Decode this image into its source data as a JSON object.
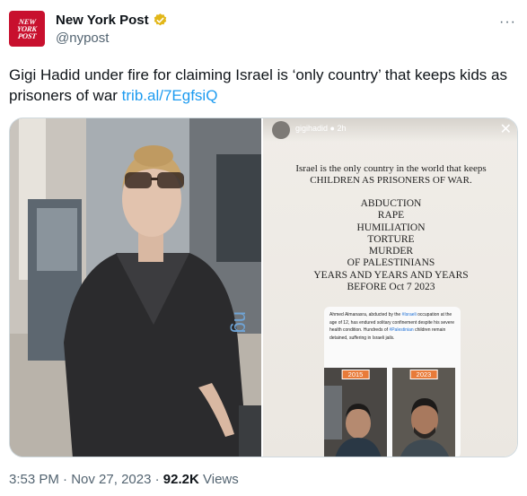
{
  "account": {
    "display_name": "New York Post",
    "handle": "@nypost",
    "avatar_text": [
      "NEW",
      "YORK",
      "POST"
    ],
    "verified": true,
    "brand_color": "#c8102e",
    "verified_color": "#e2b719"
  },
  "more_icon": "more-horizontal-icon",
  "tweet": {
    "text": "Gigi Hadid under fire for claiming Israel is ‘only country’ that keeps kids as prisoners of war",
    "link": "trib.al/7EgfsiQ"
  },
  "media": {
    "story": {
      "user": "gigihadid",
      "age": "2h",
      "line1": "Israel is the only country in the world that keeps",
      "line2": "CHILDREN AS PRISONERS OF WAR.",
      "list": [
        "ABDUCTION",
        "RAPE",
        "HUMILIATION",
        "TORTURE",
        "MURDER",
        "OF PALESTINIANS",
        "YEARS AND YEARS AND YEARS",
        "BEFORE Oct 7 2023"
      ],
      "caption_parts": [
        "Ahmed Almanasra, abducted by the ",
        "#Israeli",
        " occupation at the age of 12, has endured solitary confinement despite his severe health condition. Hundreds of ",
        "#Palestinian",
        " children remain detained, suffering in Israeli jails."
      ],
      "year_left": "2015",
      "year_right": "2023"
    }
  },
  "meta": {
    "time": "3:53 PM",
    "separator": "·",
    "date": "Nov 27, 2023",
    "views_count": "92.2K",
    "views_label": "Views"
  },
  "link_color": "#1d9bf0"
}
